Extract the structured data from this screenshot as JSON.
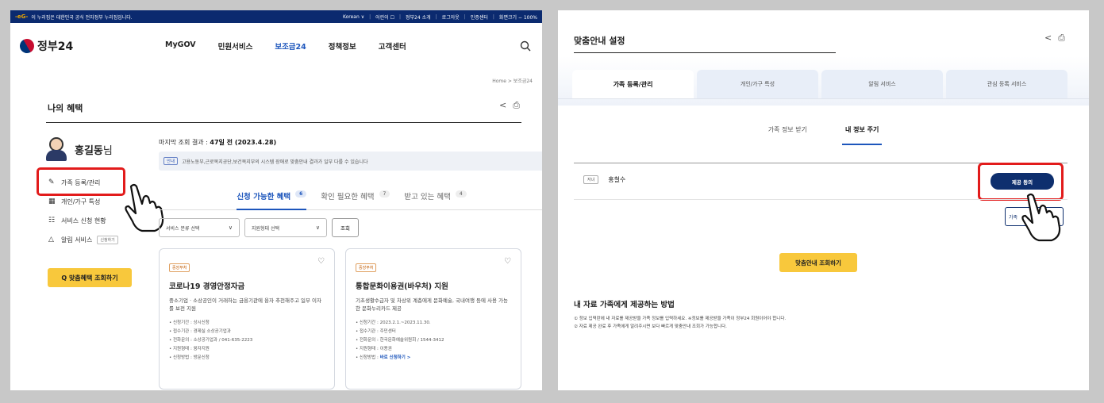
{
  "left": {
    "topbar": {
      "gov_mark": "-eG-",
      "gov_text": "이 누리집은 대한민국 공식 전자정부 누리집입니다.",
      "util": [
        "Korean ∨",
        "어린이 ☐",
        "정부24 소개",
        "로그아웃",
        "인증센터",
        "화면크기 − 100%"
      ]
    },
    "logo": "정부24",
    "menu": [
      "MyGOV",
      "민원서비스",
      "보조금24",
      "정책정보",
      "고객센터"
    ],
    "menu_active_index": 2,
    "breadcrumb": "Home > 보조금24",
    "page_title": "나의 혜택",
    "user": {
      "name": "홍길동",
      "suffix": "님"
    },
    "side_menu": [
      {
        "icon": "edit-icon",
        "glyph": "✎",
        "label": "가족 등록/관리"
      },
      {
        "icon": "home-icon",
        "glyph": "▦",
        "label": "개인/가구 특성"
      },
      {
        "icon": "clipboard-icon",
        "glyph": "☷",
        "label": "서비스 신청 현황"
      },
      {
        "icon": "bell-icon",
        "glyph": "△",
        "label": "알림 서비스",
        "tag": "신청하기"
      }
    ],
    "search_button": "Q 맞춤혜택 조회하기",
    "last_search": {
      "label": "마지막 조회 결과 :",
      "value": "47일 전 (2023.4.28)"
    },
    "notice": {
      "tag": "안내",
      "text": "고용노동부,근로복지공단,보건복지부의 시스템 장애로 맞춤안내 결과가 일부 다를 수 있습니다"
    },
    "tabs": [
      {
        "label": "신청 가능한 혜택",
        "count": "6"
      },
      {
        "label": "확인 필요한 혜택",
        "count": "7"
      },
      {
        "label": "받고 있는 혜택",
        "count": "4"
      }
    ],
    "filters": {
      "service_type": "서비스 분류 선택",
      "support_type": "지원형태 선택",
      "search": "조회"
    },
    "cards": [
      {
        "org": "중앙부처",
        "title": "코로나19 경영안정자금",
        "desc": "중소기업 · 소상공인이 거래하는 금융기관에 융자 추천해주고 일부 이자를 보전 지원",
        "items": [
          "• 신청기간 : 상시신청",
          "• 접수기관 : 경제실 소상공기업과",
          "• 전화문의 : 소상공기업과 / 041-635-2223",
          "• 지원형태 : 융자지원",
          "• 신청방법 : 방문신청"
        ],
        "link": ""
      },
      {
        "org": "중앙부처",
        "title": "통합문화이용권(바우처) 지원",
        "desc": "기초생활수급자 및 차상위 계층에게 문화예술, 국내여행 등에 사용 가능한 문화누리카드 제공",
        "items": [
          "• 신청기간 : 2023.2.1.~2023.11.30.",
          "• 접수기관 : 주민센터",
          "• 전화문의 : 한국문화예술위원회 / 1544-3412",
          "• 지원형태 : 이용권"
        ],
        "link_prefix": "• 신청방법 :",
        "link": "바로 신청하기 >"
      }
    ]
  },
  "right": {
    "title": "맞춤안내 설정",
    "tabs": [
      "가족 등록/관리",
      "개인/가구 특성",
      "알림 서비스",
      "관심 등록 서비스"
    ],
    "sub_tabs": [
      "가족 정보 받기",
      "내 정보 주기"
    ],
    "member": {
      "relation": "자녀",
      "name": "홍철수"
    },
    "consent_button": "제공 동의",
    "small_button": "가족",
    "search_button": "맞춤안내 조회하기",
    "howto_title": "내 자료 가족에게 제공하는 방법",
    "howto": [
      "① 정보 입력란에 내 자료를 제공받을 가족 정보를 입력하세요. ※정보를 제공받을 가족이 정부24 회원이어야 합니다.",
      "② 자료 제공 완료 후 가족에게 알려주시면 보다 빠르게 맞춤안내 조회가 가능합니다."
    ]
  },
  "colors": {
    "accent": "#1d56bc",
    "highlight": "#e21b1b",
    "yellow": "#f8c83c",
    "navy": "#0e2f6e"
  }
}
